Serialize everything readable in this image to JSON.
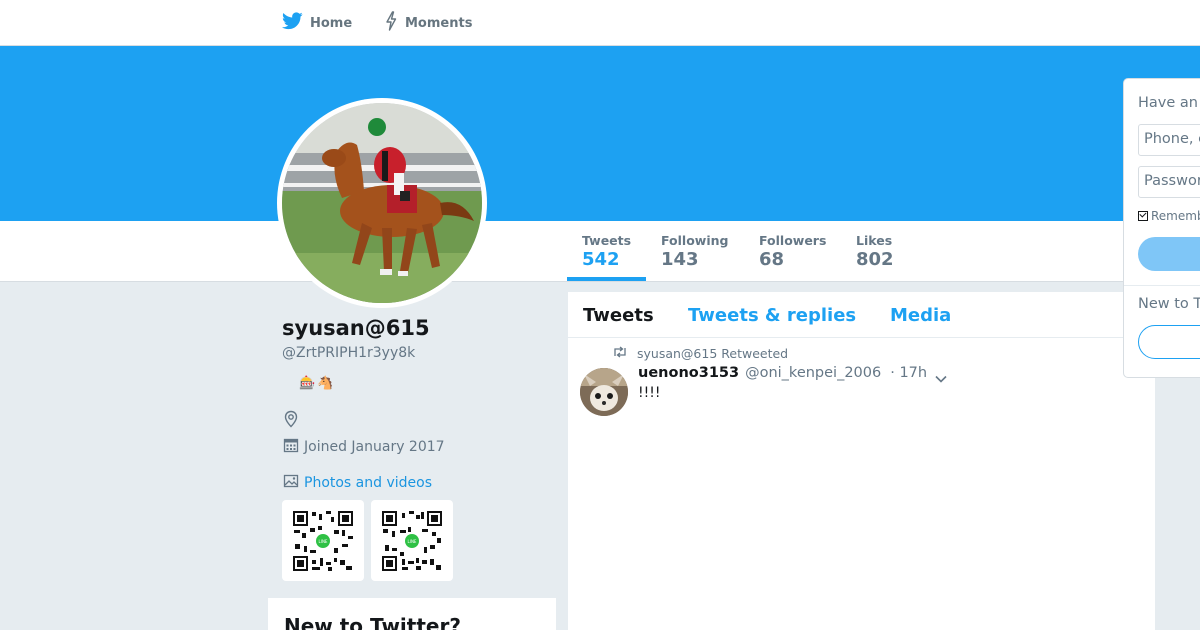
{
  "nav": {
    "home_label": "Home",
    "moments_label": "Moments"
  },
  "colors": {
    "brand": "#1da1f2",
    "background": "#e6ecf0",
    "link": "#1b95e0"
  },
  "profile": {
    "name": "syusan@615",
    "handle": "@ZrtPRIPH1r3yy8k",
    "bio_emoji": [
      "🎰",
      "🐴"
    ],
    "joined": "Joined January 2017",
    "photos_label": "Photos and videos"
  },
  "stats": [
    {
      "label": "Tweets",
      "value": "542",
      "active": true
    },
    {
      "label": "Following",
      "value": "143"
    },
    {
      "label": "Followers",
      "value": "68"
    },
    {
      "label": "Likes",
      "value": "802"
    }
  ],
  "timeline": {
    "tabs": [
      "Tweets",
      "Tweets & replies",
      "Media"
    ],
    "active_tab": "Tweets",
    "tweet": {
      "retweeted_by": "syusan@615 Retweeted",
      "fullname": "uenono3153",
      "username": "@oni_kenpei_2006",
      "time": "· 17h",
      "text": "!!!!"
    }
  },
  "login": {
    "heading": "Have an",
    "phone_placeholder": "Phone, e",
    "password_placeholder": "Passwor",
    "remember_label": "Rememb",
    "new_prompt": "New to T"
  },
  "signup_card": {
    "title": "New to Twitter?"
  },
  "icons": [
    "twitter-bird-icon",
    "moments-bolt-icon",
    "location-pin-icon",
    "calendar-icon",
    "photo-icon",
    "retweet-icon",
    "chevron-down-icon"
  ]
}
